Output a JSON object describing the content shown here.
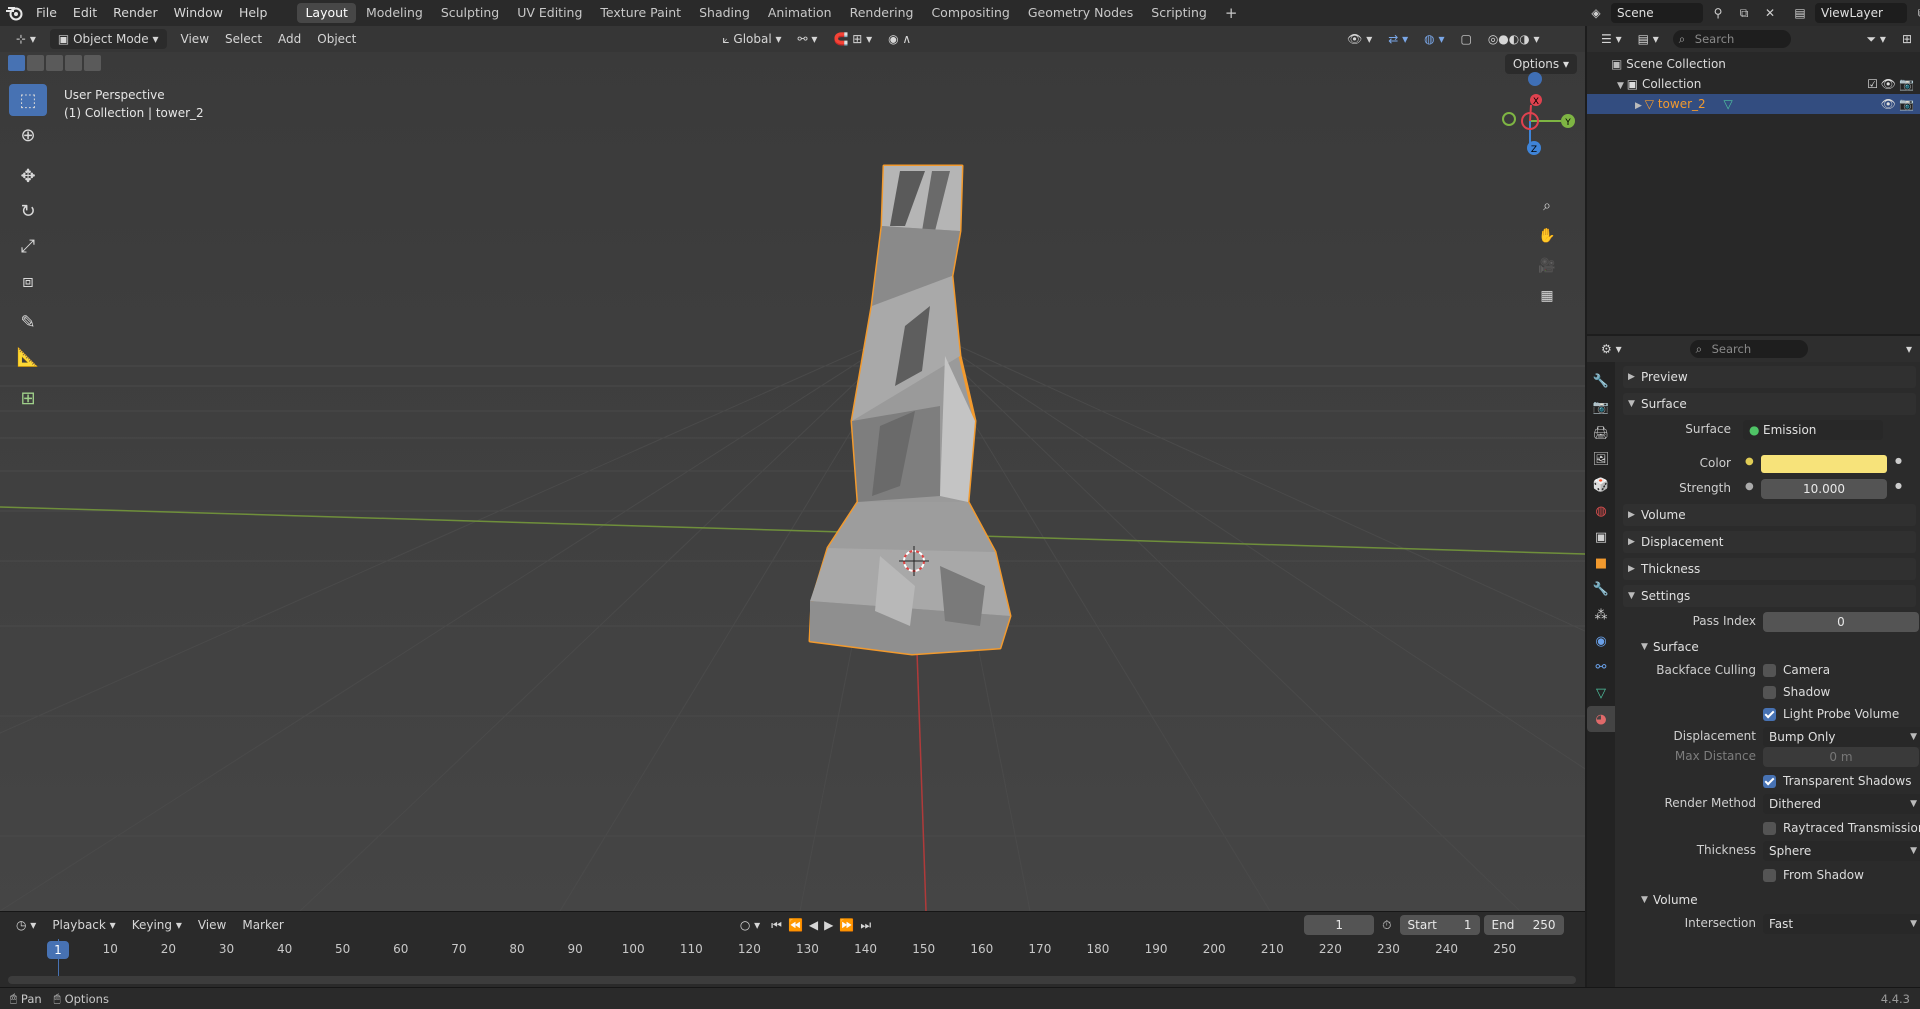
{
  "menu": {
    "items": [
      "File",
      "Edit",
      "Render",
      "Window",
      "Help"
    ]
  },
  "workspaces": {
    "tabs": [
      "Layout",
      "Modeling",
      "Sculpting",
      "UV Editing",
      "Texture Paint",
      "Shading",
      "Animation",
      "Rendering",
      "Compositing",
      "Geometry Nodes",
      "Scripting"
    ],
    "add_symbol": "+"
  },
  "scene": {
    "name": "Scene",
    "view_layer": "ViewLayer"
  },
  "viewport": {
    "mode": "Object Mode",
    "menus": [
      "View",
      "Select",
      "Add",
      "Object"
    ],
    "transform_orientation": "Global",
    "options_label": "Options",
    "perspective_label": "User Perspective",
    "collection_info": "(1) Collection | tower_2",
    "gizmo": {
      "x": "X",
      "y": "Y",
      "z": "Z"
    }
  },
  "timeline": {
    "menus": [
      "Playback",
      "Keying",
      "View",
      "Marker"
    ],
    "current_frame": "1",
    "start_label": "Start",
    "start_value": "1",
    "end_label": "End",
    "end_value": "250",
    "ticks": [
      "1",
      "10",
      "20",
      "30",
      "40",
      "50",
      "60",
      "70",
      "80",
      "90",
      "100",
      "110",
      "120",
      "130",
      "140",
      "150",
      "160",
      "170",
      "180",
      "190",
      "200",
      "210",
      "220",
      "230",
      "240",
      "250"
    ]
  },
  "statusbar": {
    "pan": "Pan",
    "options": "Options",
    "version": "4.4.3"
  },
  "outliner": {
    "search_placeholder": "Search",
    "scene_collection": "Scene Collection",
    "collection": "Collection",
    "object": "tower_2"
  },
  "properties": {
    "search_placeholder": "Search",
    "panels": {
      "preview": "Preview",
      "surface": "Surface",
      "volume": "Volume",
      "displacement": "Displacement",
      "thickness": "Thickness",
      "settings": "Settings"
    },
    "surface_label": "Surface",
    "surface_value": "Emission",
    "color_label": "Color",
    "color_value": "#f7e37a",
    "strength_label": "Strength",
    "strength_value": "10.000",
    "pass_index_label": "Pass Index",
    "pass_index_value": "0",
    "sub_surface": "Surface",
    "backface_culling_label": "Backface Culling",
    "camera_label": "Camera",
    "shadow_label": "Shadow",
    "light_probe_label": "Light Probe Volume",
    "displacement_label": "Displacement",
    "displacement_value": "Bump Only",
    "max_distance_label": "Max Distance",
    "max_distance_value": "0 m",
    "transparent_shadows_label": "Transparent Shadows",
    "render_method_label": "Render Method",
    "render_method_value": "Dithered",
    "raytraced_label": "Raytraced Transmission",
    "thickness_label": "Thickness",
    "thickness_value": "Sphere",
    "from_shadow_label": "From Shadow",
    "sub_volume": "Volume",
    "intersection_label": "Intersection",
    "intersection_value": "Fast",
    "checkboxes": {
      "camera": false,
      "shadow": false,
      "light_probe": true,
      "transparent_shadows": true,
      "raytraced": false,
      "from_shadow": false
    }
  },
  "colors": {
    "accent": "#4772b3",
    "selection_outline": "#f29a2e",
    "x_axis": "#e0424f",
    "y_axis": "#7eb543",
    "z_axis": "#3f84d8"
  }
}
